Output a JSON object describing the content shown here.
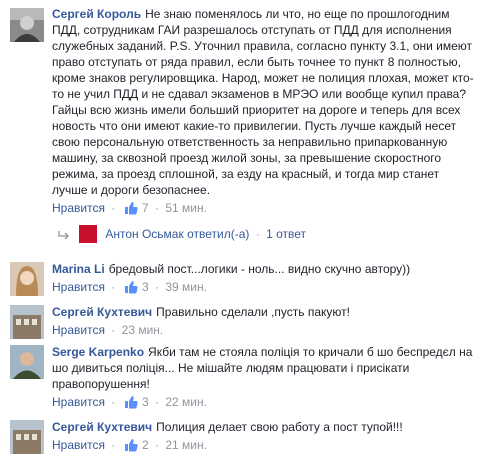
{
  "comments": [
    {
      "author": "Сергей Король",
      "text": "Не знаю поменялось ли что, но еще по прошлогодним ПДД, сотрудникам ГАИ разрешалось отступать от ПДД для исполнения служебных заданий. P.S. Уточнил правила, согласно пункту 3.1, они имеют право отступать от ряда правил, если быть точнее то пункт 8 полностью, кроме знаков регулировщика. Народ, может не полиция плохая, может кто-то не учил ПДД и не сдавал экзаменов в МРЭО или вообще купил права? Гайцы всю жизнь имели больший приоритет на дороге и теперь для всех новость что они имеют какие-то привилегии. Пусть лучше каждый несет свою персональную ответственность за неправильно припаркованную машину, за сквозной проезд жилой зоны, за превышение скоростного режима, за проезд сплошной, за езду на красный, и тогда мир станет лучше и дороги безопаснее.",
      "like_label": "Нравится",
      "likes": "7",
      "time": "51 мин."
    },
    {
      "author": "Marina Li",
      "text": "бредовый пост...логики - ноль... видно скучно автору))",
      "like_label": "Нравится",
      "likes": "3",
      "time": "39 мин."
    },
    {
      "author": "Сергей Кухтевич",
      "text": "Правильно сделали ,пусть пакуют!",
      "like_label": "Нравится",
      "likes": "",
      "time": "23 мин."
    },
    {
      "author": "Serge Karpenko",
      "text": "Якби там не стояла поліція то кричали б шо беспредєл на шо дивиться поліція... Не мішайте людям працювати і присікати правопорушення!",
      "like_label": "Нравится",
      "likes": "3",
      "time": "22 мин."
    },
    {
      "author": "Сергей Кухтевич",
      "text": "Полиция делает свою работу а пост тупой!!!",
      "like_label": "Нравится",
      "likes": "2",
      "time": "21 мин."
    }
  ],
  "reply": {
    "author": "Антон Осьмак",
    "action": "ответил(-а)",
    "count": "1 ответ"
  },
  "separator": "·",
  "colors": {
    "link": "#365899",
    "meta": "#90949c",
    "text": "#1d2129",
    "like_icon": "#5890ff",
    "reply_avatar": "#c8102e"
  }
}
